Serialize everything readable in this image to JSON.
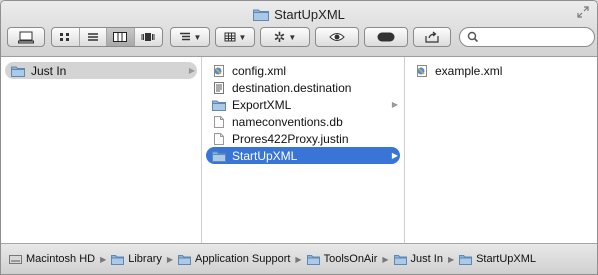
{
  "window": {
    "title": "StartUpXML"
  },
  "toolbar": {
    "buttons": [
      "back-forward",
      "icon-view",
      "list-view",
      "column-view",
      "coverflow-view",
      "arrange",
      "share",
      "action",
      "quicklook",
      "toggle",
      "share-out"
    ]
  },
  "search": {
    "placeholder": ""
  },
  "columns": {
    "col1": [
      {
        "name": "Just In",
        "kind": "folder",
        "selected": "gray",
        "arrow": true
      }
    ],
    "col2": [
      {
        "name": "config.xml",
        "kind": "xml"
      },
      {
        "name": "destination.destination",
        "kind": "doc"
      },
      {
        "name": "ExportXML",
        "kind": "folder",
        "arrow": true
      },
      {
        "name": "nameconventions.db",
        "kind": "blank"
      },
      {
        "name": "Prores422Proxy.justin",
        "kind": "blank"
      },
      {
        "name": "StartUpXML",
        "kind": "folder",
        "selected": "blue",
        "arrow": true
      }
    ],
    "col3": [
      {
        "name": "example.xml",
        "kind": "xml"
      }
    ]
  },
  "pathbar": {
    "items": [
      "Macintosh HD",
      "Library",
      "Application Support",
      "ToolsOnAir",
      "Just In",
      "StartUpXML"
    ]
  }
}
